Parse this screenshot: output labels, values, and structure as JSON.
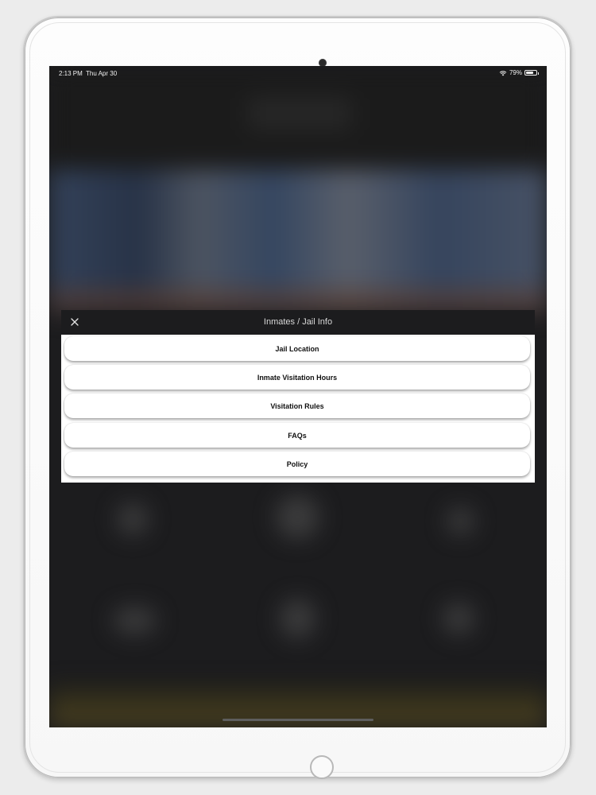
{
  "status_bar": {
    "time": "2:13 PM",
    "date": "Thu Apr 30",
    "battery": "79%",
    "battery_level": 0.79,
    "icons": [
      "wifi-icon",
      "battery-icon"
    ]
  },
  "modal": {
    "title": "Inmates / Jail Info",
    "close_icon": "close-icon",
    "items": [
      {
        "label": "Jail Location"
      },
      {
        "label": "Inmate Visitation Hours"
      },
      {
        "label": "Visitation Rules"
      },
      {
        "label": "FAQs"
      },
      {
        "label": "Policy"
      }
    ]
  },
  "colors": {
    "modal_header": "#1c1c1e",
    "modal_body": "#ffffff",
    "screen_background": "#1c1c1e"
  }
}
